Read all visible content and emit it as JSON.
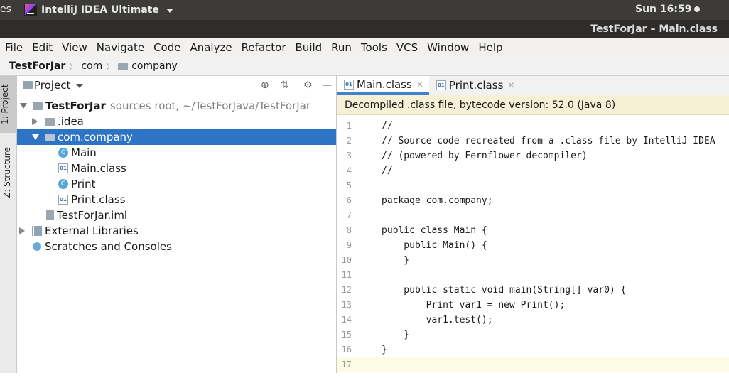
{
  "topbar": {
    "activities": "es",
    "app_name": "IntelliJ IDEA Ultimate",
    "clock": "Sun 16:59"
  },
  "window_title": "TestForJar – Main.class",
  "menu": [
    "File",
    "Edit",
    "View",
    "Navigate",
    "Code",
    "Analyze",
    "Refactor",
    "Build",
    "Run",
    "Tools",
    "VCS",
    "Window",
    "Help"
  ],
  "breadcrumb": [
    "TestForJar",
    "com",
    "company"
  ],
  "tool_strip": {
    "project_tab": "1: Project",
    "structure_tab": "Z: Structure"
  },
  "project_panel": {
    "title": "Project",
    "tree": [
      {
        "label": "TestForJar",
        "note": "sources root, ~/TestForJava/TestForJar",
        "icon": "module-folder-icon"
      },
      {
        "label": ".idea",
        "icon": "folder-icon"
      },
      {
        "label": "com.company",
        "icon": "package-icon",
        "selected": true
      },
      {
        "label": "Main",
        "icon": "class-run-icon"
      },
      {
        "label": "Main.class",
        "icon": "binary-class-icon"
      },
      {
        "label": "Print",
        "icon": "class-icon"
      },
      {
        "label": "Print.class",
        "icon": "binary-class-icon"
      },
      {
        "label": "TestForJar.iml",
        "icon": "iml-file-icon"
      },
      {
        "label": "External Libraries",
        "icon": "library-icon"
      },
      {
        "label": "Scratches and Consoles",
        "icon": "scratches-icon"
      }
    ]
  },
  "editor": {
    "tabs": [
      {
        "label": "Main.class",
        "active": true
      },
      {
        "label": "Print.class",
        "active": false
      }
    ],
    "notice": "Decompiled .class file, bytecode version: 52.0 (Java 8)",
    "lines": [
      "//",
      "// Source code recreated from a .class file by IntelliJ IDEA",
      "// (powered by Fernflower decompiler)",
      "//",
      "",
      "package com.company;",
      "",
      "public class Main {",
      "    public Main() {",
      "    }",
      "",
      "    public static void main(String[] var0) {",
      "        Print var1 = new Print();",
      "        var1.test();",
      "    }",
      "}",
      ""
    ],
    "line_numbers": [
      "1",
      "2",
      "3",
      "4",
      "5",
      "6",
      "7",
      "8",
      "9",
      "10",
      "11",
      "12",
      "13",
      "14",
      "15",
      "16",
      "17"
    ]
  }
}
